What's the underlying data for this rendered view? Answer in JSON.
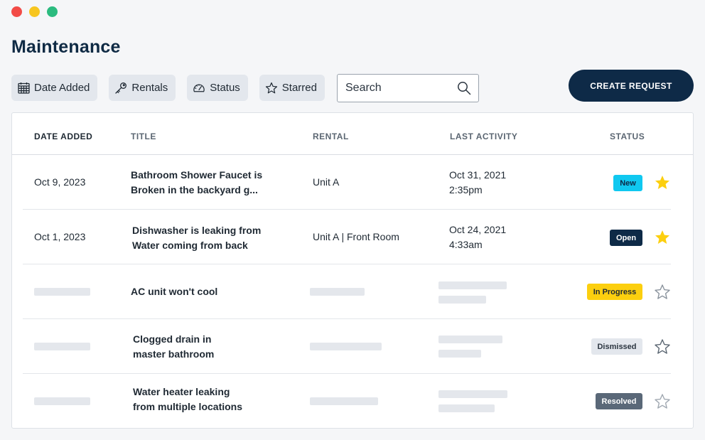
{
  "page_title": "Maintenance",
  "filters": [
    {
      "label": "Date Added",
      "icon": "calendar-icon"
    },
    {
      "label": "Rentals",
      "icon": "key-icon"
    },
    {
      "label": "Status",
      "icon": "gauge-icon"
    },
    {
      "label": "Starred",
      "icon": "star-outline-icon"
    }
  ],
  "search": {
    "placeholder": "Search",
    "icon": "search-icon"
  },
  "create_button": {
    "label": "CREATE REQUEST"
  },
  "table": {
    "headers": {
      "date_added": "DATE ADDED",
      "title": "TITLE",
      "rental": "RENTAL",
      "last_activity": "LAST ACTIVITY",
      "status": "STATUS"
    },
    "rows": [
      {
        "date": "Oct 9, 2023",
        "title_line1": "Bathroom Shower Faucet is",
        "title_line2": "Broken in the backyard g...",
        "rental": "Unit A",
        "activity_date": "Oct 31, 2021",
        "activity_time": "2:35pm",
        "status": "New",
        "starred": true
      },
      {
        "date": "Oct 1, 2023",
        "title_line1": "Dishwasher is leaking from",
        "title_line2": "Water coming from back",
        "rental": "Unit A | Front Room",
        "activity_date": "Oct 24, 2021",
        "activity_time": "4:33am",
        "status": "Open",
        "starred": true
      },
      {
        "title_line1": "AC unit won't cool",
        "status": "In Progress",
        "starred": false
      },
      {
        "title_line1": "Clogged drain in",
        "title_line2": "master bathroom",
        "status": "Dismissed",
        "starred": false
      },
      {
        "title_line1": "Water heater leaking",
        "title_line2": "from multiple locations",
        "status": "Resolved",
        "starred": false
      }
    ]
  },
  "colors": {
    "brand": "#0e2a47",
    "status_new": "#10c8f0",
    "status_open": "#0e2a47",
    "status_in_progress": "#fccf0f",
    "status_dismissed": "#e3e7ed",
    "status_resolved": "#5a6878",
    "star_filled": "#fccf0f"
  }
}
